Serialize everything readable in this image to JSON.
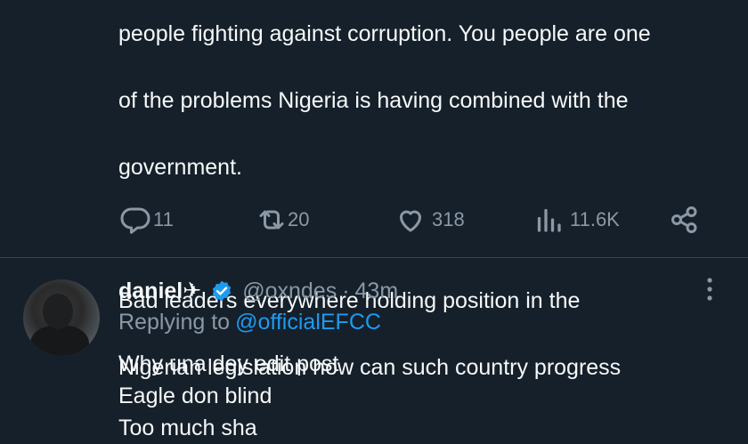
{
  "main_tweet": {
    "text_lines": [
      "people fighting against corruption. You people are one",
      "of the problems Nigeria is having combined with the",
      "government.",
      "",
      "Bad leaders everywhere holding position in the",
      "Nigerian legislation how can such country progress"
    ],
    "actions": {
      "replies": "11",
      "reposts": "20",
      "likes": "318",
      "views": "11.6K"
    }
  },
  "reply": {
    "display_name": "daniel✈",
    "handle": "@oxndes",
    "separator": "·",
    "time": "43m",
    "replying_prefix": "Replying to",
    "replying_to": "@officialEFCC",
    "text_lines": [
      "Why una dey edit post",
      "Eagle don blind",
      "Too much sha"
    ]
  },
  "colors": {
    "background": "#15202b",
    "text": "#f7f9f9",
    "muted": "#8b98a5",
    "accent": "#1d9bf0"
  },
  "icons": [
    "reply-icon",
    "repost-icon",
    "like-icon",
    "views-icon",
    "share-icon",
    "verified-badge-icon",
    "more-icon"
  ]
}
